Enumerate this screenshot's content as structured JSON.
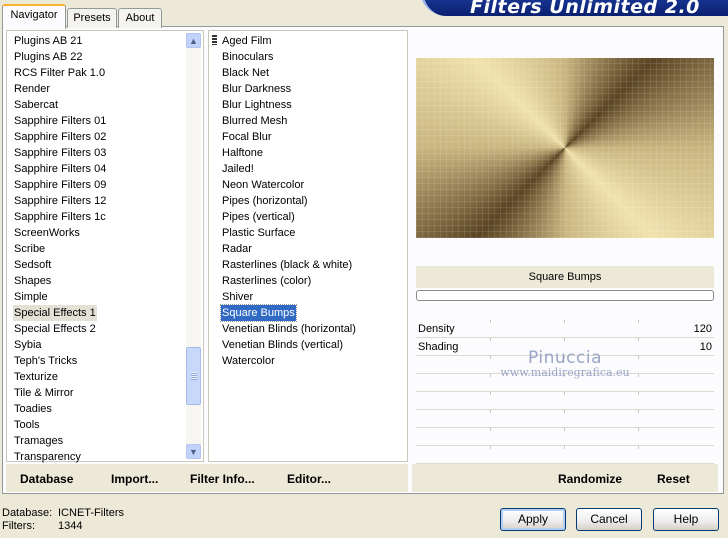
{
  "tabs": [
    "Navigator",
    "Presets",
    "About"
  ],
  "banner_title": "Filters Unlimited 2.0",
  "categories": [
    "Plugins AB 21",
    "Plugins AB 22",
    "RCS Filter Pak 1.0",
    "Render",
    "Sabercat",
    "Sapphire Filters 01",
    "Sapphire Filters 02",
    "Sapphire Filters 03",
    "Sapphire Filters 04",
    "Sapphire Filters 09",
    "Sapphire Filters 12",
    "Sapphire Filters 1c",
    "ScreenWorks",
    "Scribe",
    "Sedsoft",
    "Shapes",
    "Simple",
    "Special Effects 1",
    "Special Effects 2",
    "Sybia",
    "Teph's Tricks",
    "Texturize",
    "Tile & Mirror",
    "Toadies",
    "Tools",
    "Tramages",
    "Transparency"
  ],
  "selected_category": "Special Effects 1",
  "filters": [
    "Aged Film",
    "Binoculars",
    "Black Net",
    "Blur Darkness",
    "Blur Lightness",
    "Blurred Mesh",
    "Focal Blur",
    "Halftone",
    "Jailed!",
    "Neon Watercolor",
    "Pipes (horizontal)",
    "Pipes (vertical)",
    "Plastic Surface",
    "Radar",
    "Rasterlines (black & white)",
    "Rasterlines (color)",
    "Shiver",
    "Square Bumps",
    "Venetian Blinds (horizontal)",
    "Venetian Blinds (vertical)",
    "Watercolor"
  ],
  "selected_filter": "Square Bumps",
  "filter_name": "Square Bumps",
  "params": [
    {
      "name": "Density",
      "value": "120"
    },
    {
      "name": "Shading",
      "value": "10"
    }
  ],
  "watermark": {
    "line1": "Pinuccia",
    "line2": "www.maidiregrafica.eu"
  },
  "left_actions": {
    "database": "Database",
    "import": "Import...",
    "filter_info": "Filter Info...",
    "editor": "Editor..."
  },
  "right_actions": {
    "randomize": "Randomize",
    "reset": "Reset"
  },
  "footer": {
    "db_label": "Database:",
    "db_value": "ICNET-Filters",
    "filters_label": "Filters:",
    "filters_value": "1344"
  },
  "buttons": {
    "apply": "Apply",
    "cancel": "Cancel",
    "help": "Help"
  }
}
